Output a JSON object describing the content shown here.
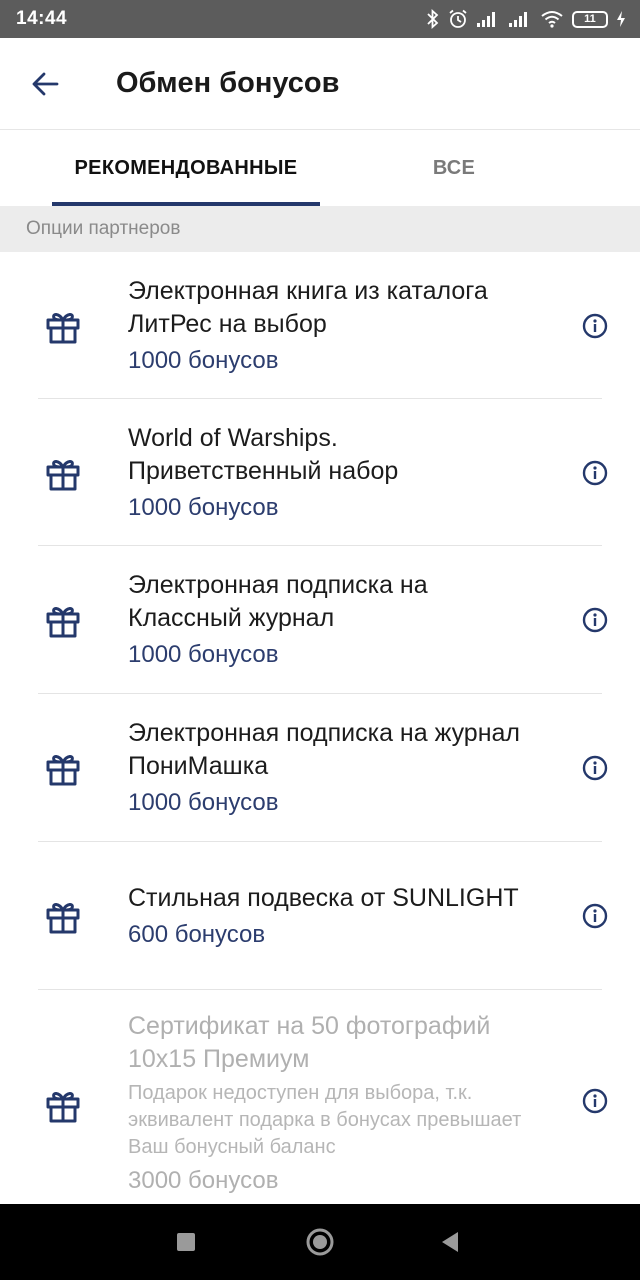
{
  "status_bar": {
    "time": "14:44",
    "battery": "11"
  },
  "app_bar": {
    "title": "Обмен бонусов"
  },
  "tabs": [
    {
      "label": "РЕКОМЕНДОВАННЫЕ",
      "active": true
    },
    {
      "label": "ВСЕ",
      "active": false
    }
  ],
  "section": {
    "label": "Опции партнеров"
  },
  "items": [
    {
      "title": "Электронная книга из каталога ЛитРес на выбор",
      "price": "1000 бонусов",
      "icon": "gift-icon"
    },
    {
      "title": "World of Warships. Приветственный набор",
      "price": "1000 бонусов",
      "icon": "gift-icon"
    },
    {
      "title": "Электронная подписка на Классный журнал",
      "price": "1000 бонусов",
      "icon": "gift-icon"
    },
    {
      "title": "Электронная подписка на журнал ПониМашка",
      "price": "1000 бонусов",
      "icon": "gift-icon"
    },
    {
      "title": "Стильная подвеска от SUNLIGHT",
      "price": "600 бонусов",
      "icon": "gift-icon"
    },
    {
      "title": "Сертификат на 50 фотографий 10х15 Премиум",
      "note": "Подарок недоступен для выбора, т.к. эквивалент подарка в бонусах превышает Ваш бонусный баланс",
      "price": "3000 бонусов",
      "icon": "gift-icon",
      "disabled": true
    }
  ],
  "colors": {
    "accent": "#24386b",
    "price": "#2c3d6e",
    "status_bar": "#5c5c5c",
    "section_bg": "#ececec"
  }
}
